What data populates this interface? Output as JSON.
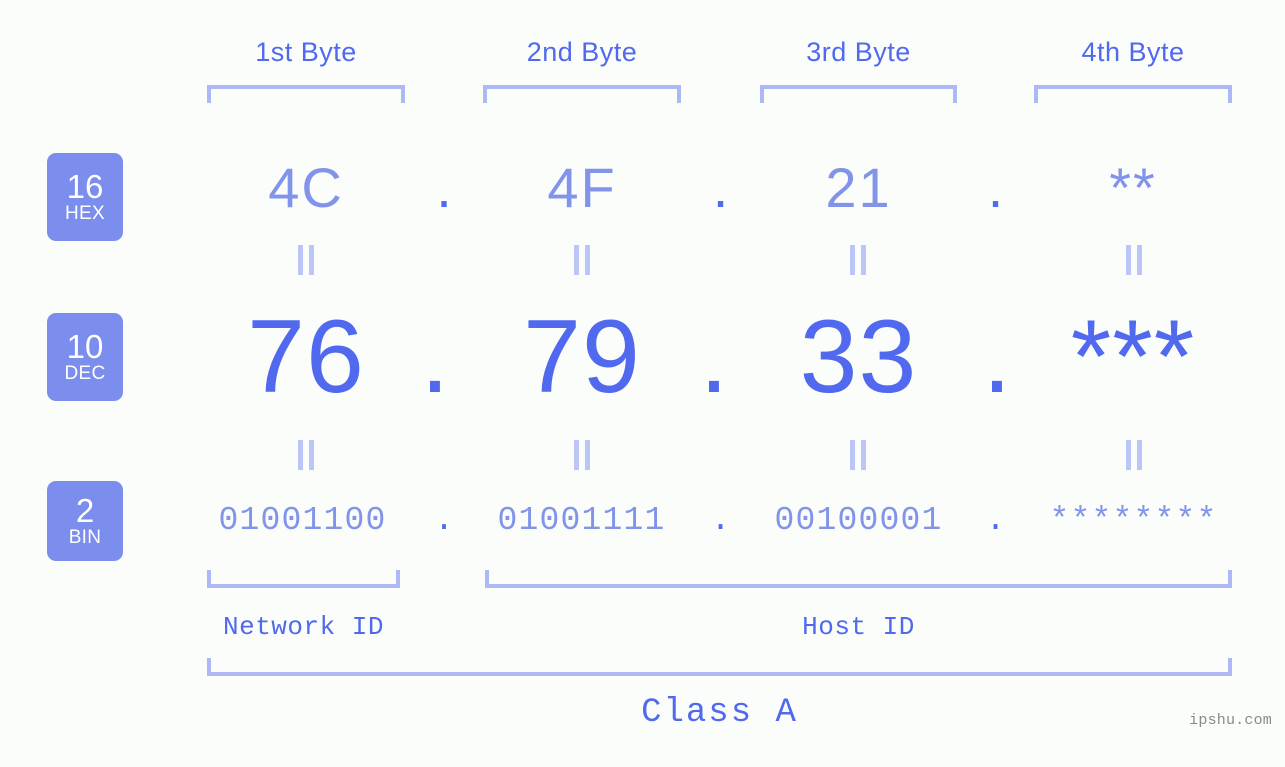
{
  "bytes": [
    {
      "header": "1st Byte"
    },
    {
      "header": "2nd Byte"
    },
    {
      "header": "3rd Byte"
    },
    {
      "header": "4th Byte"
    }
  ],
  "bases": [
    {
      "number": "16",
      "name": "HEX"
    },
    {
      "number": "10",
      "name": "DEC"
    },
    {
      "number": "2",
      "name": "BIN"
    }
  ],
  "rows": {
    "hex": {
      "base_number": "16",
      "base_name": "HEX",
      "values": [
        "4C",
        "4F",
        "21",
        "**"
      ]
    },
    "dec": {
      "base_number": "10",
      "base_name": "DEC",
      "values": [
        "76",
        "79",
        "33",
        "***"
      ]
    },
    "bin": {
      "base_number": "2",
      "base_name": "BIN",
      "values": [
        "01001100",
        "01001111",
        "00100001",
        "********"
      ]
    }
  },
  "separator": ".",
  "equality_marker": "=",
  "segments": {
    "network_id": "Network ID",
    "host_id": "Host ID"
  },
  "class_label": "Class A",
  "watermark": "ipshu.com",
  "colors": {
    "background": "#fbfdfa",
    "accent_strong": "#5069ef",
    "accent_light": "#8294ea",
    "bracket": "#adb8f5",
    "badge_bg": "#7b8ded",
    "badge_text": "#ffffff",
    "equality": "#bcc5f7",
    "watermark": "#8a8a8a"
  }
}
